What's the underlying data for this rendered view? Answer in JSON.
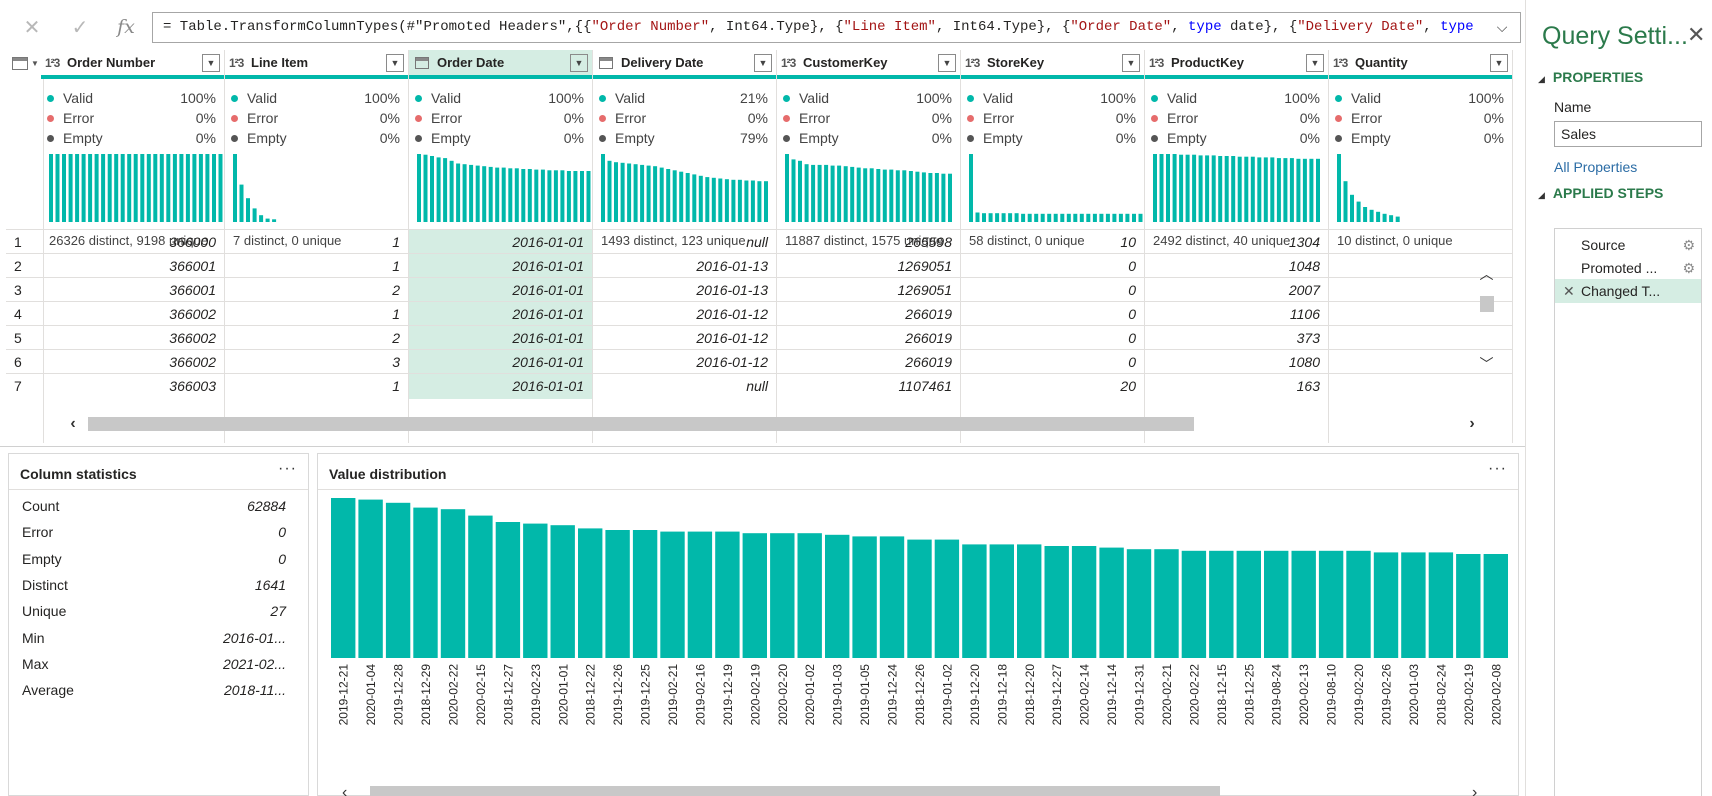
{
  "formula_bar": {
    "cancel_icon": "close-icon",
    "commit_icon": "check-icon",
    "fx_label": "fx",
    "segments": [
      {
        "t": "= Table.TransformColumnTypes(#\"Promoted Headers\",{{",
        "c": ""
      },
      {
        "t": "\"Order Number\"",
        "c": "str"
      },
      {
        "t": ", Int64.Type}, {",
        "c": ""
      },
      {
        "t": "\"Line Item\"",
        "c": "str"
      },
      {
        "t": ", Int64.Type}, {",
        "c": ""
      },
      {
        "t": "\"Order Date\"",
        "c": "str"
      },
      {
        "t": ", ",
        "c": ""
      },
      {
        "t": "type",
        "c": "kw"
      },
      {
        "t": " date}, {",
        "c": ""
      },
      {
        "t": "\"Delivery Date\"",
        "c": "str"
      },
      {
        "t": ", ",
        "c": ""
      },
      {
        "t": "type",
        "c": "kw"
      }
    ]
  },
  "grid": {
    "row_numbers": [
      "1",
      "2",
      "3",
      "4",
      "5",
      "6",
      "7"
    ],
    "columns": [
      {
        "name": "Order Number",
        "type": "int",
        "type_label": "1²3",
        "selected": false,
        "valid": "100%",
        "error": "0%",
        "empty": "0%",
        "spark": [
          1,
          1,
          1,
          1,
          1,
          1,
          1,
          1,
          1,
          1,
          1,
          1,
          1,
          1,
          1,
          1,
          1,
          1,
          1,
          1,
          1,
          1,
          1,
          1,
          1,
          1,
          1,
          1
        ],
        "distinct": "26326 distinct, 9198 unique",
        "cells": [
          "366000",
          "366001",
          "366001",
          "366002",
          "366002",
          "366002",
          "366003"
        ]
      },
      {
        "name": "Line Item",
        "type": "int",
        "type_label": "1²3",
        "selected": false,
        "valid": "100%",
        "error": "0%",
        "empty": "0%",
        "spark": [
          1,
          0.55,
          0.35,
          0.2,
          0.1,
          0.05,
          0.04
        ],
        "distinct": "7 distinct, 0 unique",
        "cells": [
          "1",
          "1",
          "2",
          "1",
          "2",
          "3",
          "1"
        ]
      },
      {
        "name": "Order Date",
        "type": "date",
        "type_label": "",
        "selected": true,
        "valid": "100%",
        "error": "0%",
        "empty": "0%",
        "spark": [
          1,
          0.99,
          0.97,
          0.95,
          0.94,
          0.9,
          0.86,
          0.85,
          0.84,
          0.83,
          0.82,
          0.81,
          0.8,
          0.8,
          0.79,
          0.79,
          0.78,
          0.78,
          0.77,
          0.77,
          0.76,
          0.76,
          0.76,
          0.75,
          0.75,
          0.75,
          0.75
        ],
        "distinct": "1641 distinct, 27 unique",
        "cells": [
          "2016-01-01",
          "2016-01-01",
          "2016-01-01",
          "2016-01-01",
          "2016-01-01",
          "2016-01-01",
          "2016-01-01"
        ]
      },
      {
        "name": "Delivery Date",
        "type": "date",
        "type_label": "",
        "selected": false,
        "valid": "21%",
        "error": "0%",
        "empty": "79%",
        "spark": [
          1,
          0.9,
          0.88,
          0.87,
          0.86,
          0.85,
          0.84,
          0.83,
          0.82,
          0.8,
          0.78,
          0.76,
          0.74,
          0.72,
          0.7,
          0.68,
          0.66,
          0.65,
          0.64,
          0.63,
          0.62,
          0.62,
          0.61,
          0.61,
          0.6,
          0.6
        ],
        "distinct": "1493 distinct, 123 unique",
        "cells": [
          "null",
          "2016-01-13",
          "2016-01-13",
          "2016-01-12",
          "2016-01-12",
          "2016-01-12",
          "null"
        ]
      },
      {
        "name": "CustomerKey",
        "type": "int",
        "type_label": "1²3",
        "selected": false,
        "valid": "100%",
        "error": "0%",
        "empty": "0%",
        "spark": [
          1,
          0.92,
          0.9,
          0.85,
          0.84,
          0.84,
          0.84,
          0.83,
          0.83,
          0.82,
          0.81,
          0.8,
          0.79,
          0.79,
          0.78,
          0.77,
          0.77,
          0.76,
          0.76,
          0.75,
          0.74,
          0.73,
          0.72,
          0.72,
          0.71,
          0.71
        ],
        "distinct": "11887 distinct, 1575 unique",
        "cells": [
          "265598",
          "1269051",
          "1269051",
          "266019",
          "266019",
          "266019",
          "1107461"
        ]
      },
      {
        "name": "StoreKey",
        "type": "int",
        "type_label": "1²3",
        "selected": false,
        "valid": "100%",
        "error": "0%",
        "empty": "0%",
        "spark": [
          1,
          0.14,
          0.13,
          0.13,
          0.13,
          0.13,
          0.13,
          0.13,
          0.12,
          0.12,
          0.12,
          0.12,
          0.12,
          0.12,
          0.12,
          0.12,
          0.12,
          0.12,
          0.12,
          0.12,
          0.12,
          0.12,
          0.12,
          0.12,
          0.12,
          0.12,
          0.12
        ],
        "distinct": "58 distinct, 0 unique",
        "cells": [
          "10",
          "0",
          "0",
          "0",
          "0",
          "0",
          "20"
        ]
      },
      {
        "name": "ProductKey",
        "type": "int",
        "type_label": "1²3",
        "selected": false,
        "valid": "100%",
        "error": "0%",
        "empty": "0%",
        "spark": [
          1,
          1,
          1,
          1,
          0.99,
          0.99,
          0.99,
          0.98,
          0.98,
          0.98,
          0.97,
          0.97,
          0.97,
          0.96,
          0.96,
          0.96,
          0.95,
          0.95,
          0.95,
          0.94,
          0.94,
          0.94,
          0.93,
          0.93,
          0.93,
          0.93
        ],
        "distinct": "2492 distinct, 40 unique",
        "cells": [
          "1304",
          "1048",
          "2007",
          "1106",
          "373",
          "1080",
          "163"
        ]
      },
      {
        "name": "Quantity",
        "type": "int",
        "type_label": "1²3",
        "selected": false,
        "valid": "100%",
        "error": "0%",
        "empty": "0%",
        "spark": [
          1,
          0.6,
          0.4,
          0.3,
          0.22,
          0.18,
          0.15,
          0.12,
          0.1,
          0.08
        ],
        "distinct": "10 distinct, 0 unique",
        "cells": [
          "",
          "",
          "",
          "",
          "",
          "",
          ""
        ]
      }
    ],
    "quality_labels": {
      "valid": "Valid",
      "error": "Error",
      "empty": "Empty"
    }
  },
  "column_statistics": {
    "title": "Column statistics",
    "more_icon": "more-icon",
    "rows": [
      {
        "label": "Count",
        "value": "62884"
      },
      {
        "label": "Error",
        "value": "0"
      },
      {
        "label": "Empty",
        "value": "0"
      },
      {
        "label": "Distinct",
        "value": "1641"
      },
      {
        "label": "Unique",
        "value": "27"
      },
      {
        "label": "Min",
        "value": "2016-01..."
      },
      {
        "label": "Max",
        "value": "2021-02..."
      },
      {
        "label": "Average",
        "value": "2018-11..."
      }
    ]
  },
  "value_distribution": {
    "title": "Value distribution",
    "more_icon": "more-icon"
  },
  "chart_data": {
    "type": "bar",
    "categories": [
      "2019-12-21",
      "2020-01-04",
      "2019-12-28",
      "2018-12-29",
      "2020-02-22",
      "2020-02-15",
      "2018-12-27",
      "2019-02-23",
      "2020-01-01",
      "2018-12-22",
      "2019-12-26",
      "2019-12-25",
      "2019-02-21",
      "2019-02-16",
      "2019-12-19",
      "2020-02-19",
      "2020-02-20",
      "2020-01-02",
      "2019-01-03",
      "2019-01-05",
      "2019-12-24",
      "2018-12-26",
      "2019-01-02",
      "2019-12-20",
      "2019-12-18",
      "2018-12-20",
      "2019-12-27",
      "2020-02-14",
      "2019-12-14",
      "2019-12-31",
      "2020-02-21",
      "2020-02-22",
      "2018-12-15",
      "2018-12-25",
      "2019-08-24",
      "2020-02-13",
      "2019-08-10",
      "2019-02-20",
      "2019-02-26",
      "2020-01-03",
      "2018-02-24",
      "2020-02-19",
      "2020-02-08"
    ],
    "values": [
      100,
      99,
      97,
      94,
      93,
      89,
      85,
      84,
      83,
      81,
      80,
      80,
      79,
      79,
      79,
      78,
      78,
      78,
      77,
      76,
      76,
      74,
      74,
      71,
      71,
      71,
      70,
      70,
      69,
      68,
      68,
      67,
      67,
      67,
      67,
      67,
      67,
      67,
      66,
      66,
      66,
      65,
      65
    ],
    "ylim": [
      0,
      100
    ],
    "grid": false,
    "color": "#01b8aa"
  },
  "query_settings": {
    "title": "Query Setti...",
    "close_icon": "close-icon",
    "properties_heading": "PROPERTIES",
    "name_label": "Name",
    "name_value": "Sales",
    "all_properties": "All Properties",
    "steps_heading": "APPLIED STEPS",
    "steps": [
      {
        "label": "Source",
        "gear": true,
        "selected": false,
        "deletable": false
      },
      {
        "label": "Promoted ...",
        "gear": true,
        "selected": false,
        "deletable": false
      },
      {
        "label": "Changed T...",
        "gear": false,
        "selected": true,
        "deletable": true
      }
    ]
  },
  "colors": {
    "accent": "#01b8aa",
    "selected_bg": "#d5ede3",
    "heading_green": "#2b7a4b",
    "link_blue": "#2b6ca5"
  }
}
